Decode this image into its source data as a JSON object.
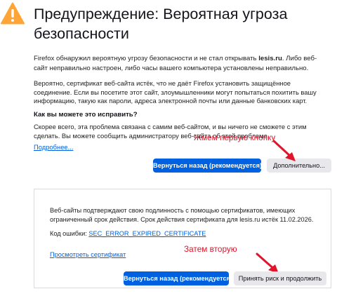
{
  "header": {
    "title": "Предупреждение: Вероятная угроза безопасности",
    "icon": "warning-icon",
    "icon_color": "#ffa436"
  },
  "intro": {
    "text_before": "Firefox обнаружил вероятную угрозу безопасности и не стал открывать ",
    "site": "lesis.ru",
    "text_after": ". Либо веб-сайт неправильно настроен, либо часы вашего компьютера установлены неправильно."
  },
  "explanation": "Вероятно, сертификат веб-сайта истёк, что не даёт Firefox установить защищённое соединение. Если вы посетите этот сайт, злоумышленники могут попытаться похитить вашу информацию, такую как пароли, адреса электронной почты или данные банковских карт.",
  "fix": {
    "heading": "Как вы можете это исправить?",
    "text": "Скорее всего, эта проблема связана с самим веб-сайтом, и вы ничего не сможете с этим сделать. Вы можете сообщить администратору веб-сайта об этой проблеме.",
    "more_link": "Подробнее..."
  },
  "actions": {
    "back_label": "Вернуться назад (рекомендуется)",
    "advanced_label": "Дополнительно..."
  },
  "advanced_panel": {
    "text": "Веб-сайты подтверждают свою подлинность с помощью сертификатов, имеющих ограниченный срок действия. Срок действия сертификата для lesis.ru истёк 11.02.2026.",
    "error_label": "Код ошибки: ",
    "error_code": "SEC_ERROR_EXPIRED_CERTIFICATE",
    "view_cert_link": "Просмотреть сертификат",
    "back_label": "Вернуться назад (рекомендуется)",
    "accept_label": "Принять риск и продолжить"
  },
  "annotations": {
    "first": "Жмем первую кнопку",
    "second": "Затем вторую",
    "color": "#e0142a"
  },
  "colors": {
    "primary": "#0061e0",
    "secondary": "#e8e8ec",
    "link": "#0061e0"
  }
}
